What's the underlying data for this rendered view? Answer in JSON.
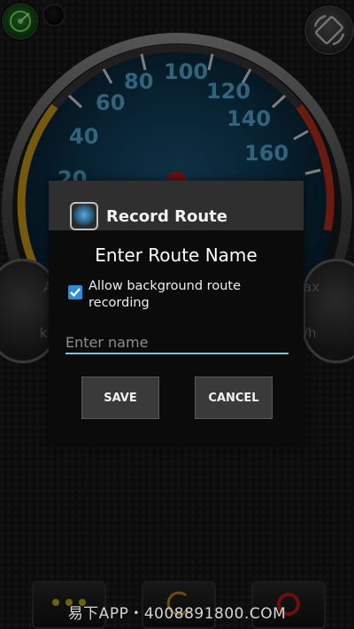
{
  "gauge": {
    "ticks": [
      "20",
      "40",
      "60",
      "80",
      "100",
      "120",
      "140",
      "160"
    ],
    "left_pod": {
      "top": "A",
      "bottom": "km"
    },
    "right_pod": {
      "top": "ax",
      "bottom": "/h"
    }
  },
  "dialog": {
    "title": "Record Route",
    "subtitle": "Enter Route Name",
    "checkbox_label": "Allow background route recording",
    "checkbox_checked": true,
    "name_placeholder": "Enter name",
    "name_value": "",
    "save_label": "SAVE",
    "cancel_label": "CANCEL"
  },
  "colors": {
    "accent": "#2a8fd6",
    "input_underline": "#7fc3d6",
    "gauge_face": "#0f3c57",
    "tick_text": "#5ab4e0"
  },
  "watermark": "易下APP・4008891800.COM"
}
